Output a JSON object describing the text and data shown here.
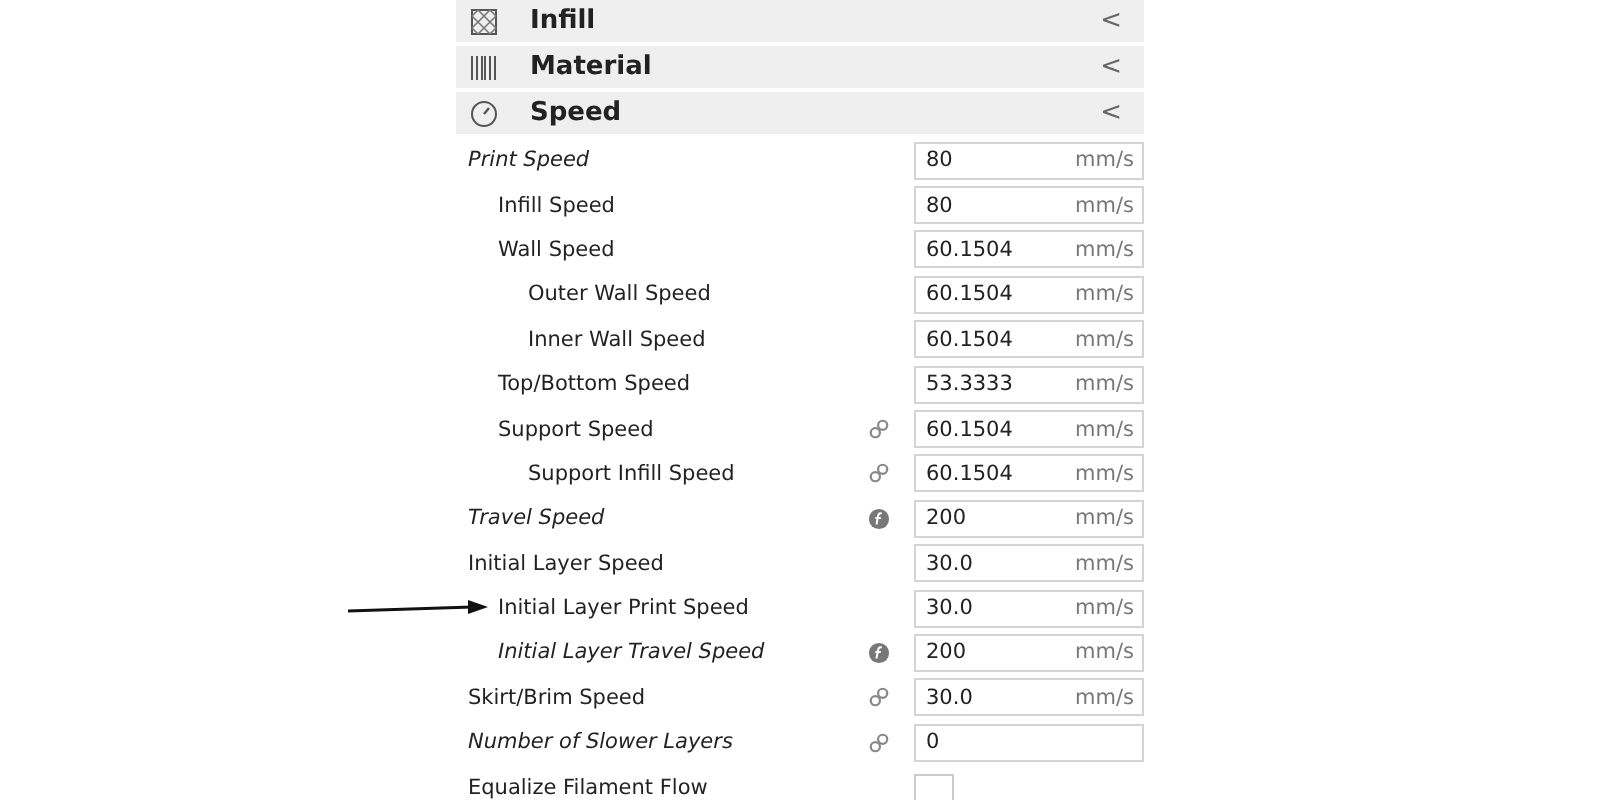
{
  "categories": [
    {
      "label": "Infill",
      "collapse_glyph": "<"
    },
    {
      "label": "Material",
      "collapse_glyph": "<"
    },
    {
      "label": "Speed",
      "collapse_glyph": "<"
    }
  ],
  "settings": [
    {
      "label": "Print Speed",
      "modified": true,
      "linked": false,
      "formula": false,
      "kind": "number",
      "value": "80",
      "unit": "mm/s",
      "children": [
        {
          "label": "Infill Speed",
          "modified": false,
          "linked": false,
          "formula": false,
          "kind": "number",
          "value": "80",
          "unit": "mm/s"
        },
        {
          "label": "Wall Speed",
          "modified": false,
          "linked": false,
          "formula": false,
          "kind": "number",
          "value": "60.1504",
          "unit": "mm/s",
          "children": [
            {
              "label": "Outer Wall Speed",
              "modified": false,
              "linked": false,
              "formula": false,
              "kind": "number",
              "value": "60.1504",
              "unit": "mm/s"
            },
            {
              "label": "Inner Wall Speed",
              "modified": false,
              "linked": false,
              "formula": false,
              "kind": "number",
              "value": "60.1504",
              "unit": "mm/s"
            }
          ]
        },
        {
          "label": "Top/Bottom Speed",
          "modified": false,
          "linked": false,
          "formula": false,
          "kind": "number",
          "value": "53.3333",
          "unit": "mm/s"
        },
        {
          "label": "Support Speed",
          "modified": false,
          "linked": true,
          "formula": false,
          "kind": "number",
          "value": "60.1504",
          "unit": "mm/s",
          "children": [
            {
              "label": "Support Infill Speed",
              "modified": false,
              "linked": true,
              "formula": false,
              "kind": "number",
              "value": "60.1504",
              "unit": "mm/s"
            }
          ]
        }
      ]
    },
    {
      "label": "Travel Speed",
      "modified": true,
      "linked": false,
      "formula": true,
      "kind": "number",
      "value": "200",
      "unit": "mm/s"
    },
    {
      "label": "Initial Layer Speed",
      "modified": false,
      "linked": false,
      "formula": false,
      "kind": "number",
      "value": "30.0",
      "unit": "mm/s",
      "children": [
        {
          "label": "Initial Layer Print Speed",
          "modified": false,
          "linked": false,
          "formula": false,
          "kind": "number",
          "value": "30.0",
          "unit": "mm/s"
        },
        {
          "label": "Initial Layer Travel Speed",
          "modified": true,
          "linked": false,
          "formula": true,
          "kind": "number",
          "value": "200",
          "unit": "mm/s"
        }
      ]
    },
    {
      "label": "Skirt/Brim Speed",
      "modified": false,
      "linked": true,
      "formula": false,
      "kind": "number",
      "value": "30.0",
      "unit": "mm/s"
    },
    {
      "label": "Number of Slower Layers",
      "modified": true,
      "linked": true,
      "formula": false,
      "kind": "number",
      "value": "0"
    },
    {
      "label": "Equalize Filament Flow",
      "modified": false,
      "linked": false,
      "formula": false,
      "kind": "checkbox",
      "checked": false
    }
  ]
}
